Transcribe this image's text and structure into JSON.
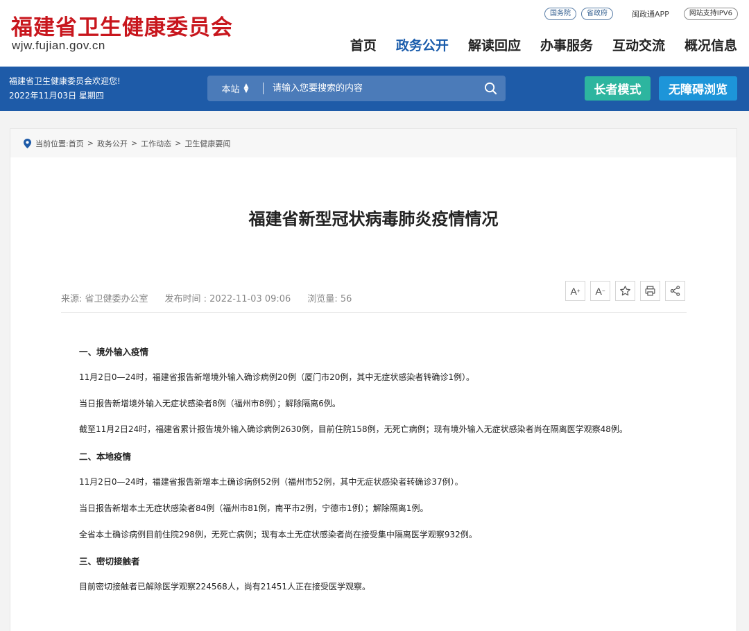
{
  "header": {
    "logo_cn": "福建省卫生健康委员会",
    "logo_url": "wjw.fujian.gov.cn",
    "top_links": {
      "guowuyuan": "国务院",
      "shengzhengfu": "省政府",
      "app": "闽政通APP",
      "ipv6": "网站支持IPV6"
    },
    "nav": [
      "首页",
      "政务公开",
      "解读回应",
      "办事服务",
      "互动交流",
      "概况信息"
    ]
  },
  "bluebar": {
    "welcome": "福建省卫生健康委员会欢迎您!",
    "date": "2022年11月03日 星期四",
    "search": {
      "scope": "本站",
      "placeholder": "请输入您要搜索的内容"
    },
    "elder_mode": "长者模式",
    "accessible": "无障碍浏览"
  },
  "breadcrumb": {
    "label": "当前位置:",
    "items": [
      "首页",
      "政务公开",
      "工作动态",
      "卫生健康要闻"
    ]
  },
  "article": {
    "title": "福建省新型冠状病毒肺炎疫情情况",
    "source": "来源:  省卫健委办公室",
    "publish_time": "发布时间 : 2022-11-03 09:06",
    "views": "浏览量:  56",
    "tools": {
      "font_up": "A",
      "font_down": "A"
    },
    "paragraphs": [
      "一、境外输入疫情",
      "11月2日0—24时，福建省报告新增境外输入确诊病例20例（厦门市20例，其中无症状感染者转确诊1例）。",
      "当日报告新增境外输入无症状感染者8例（福州市8例）；解除隔离6例。",
      "截至11月2日24时，福建省累计报告境外输入确诊病例2630例，目前住院158例，无死亡病例；现有境外输入无症状感染者尚在隔离医学观察48例。",
      "二、本地疫情",
      "11月2日0—24时，福建省报告新增本土确诊病例52例（福州市52例，其中无症状感染者转确诊37例）。",
      "当日报告新增本土无症状感染者84例（福州市81例，南平市2例，宁德市1例）；解除隔离1例。",
      "全省本土确诊病例目前住院298例，无死亡病例；现有本土无症状感染者尚在接受集中隔离医学观察932例。",
      "三、密切接触者",
      "目前密切接触者已解除医学观察224568人，尚有21451人正在接受医学观察。"
    ]
  },
  "colors": {
    "brand_red": "#c8161d",
    "bar_blue": "#1e5ba8",
    "nav_active": "#1a5cab",
    "elder_green": "#2db59f",
    "access_blue": "#1d95d9"
  }
}
